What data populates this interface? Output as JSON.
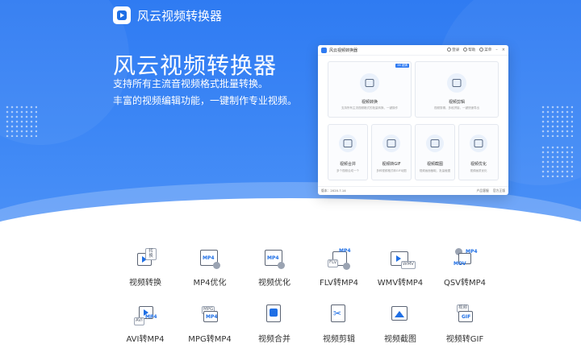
{
  "brand": {
    "name": "风云视频转换器"
  },
  "hero": {
    "title": "风云视频转换器",
    "line1": "支持所有主流音视频格式批量转换。",
    "line2": "丰富的视频编辑功能，一键制作专业视频。"
  },
  "app_window": {
    "title": "风云视频转换器",
    "controls": {
      "login": "登录",
      "menu": "帮助",
      "feedback": "菜单"
    },
    "cards": [
      {
        "label": "视频转换",
        "desc": "支持所有主流视频格式的批量转换，一键操作",
        "badge": "4K 超清"
      },
      {
        "label": "视频剪辑",
        "desc": "视频剪辑，多段拼接，一键快速导出"
      },
      {
        "label": "视频合并",
        "desc": "多个视频合成一个"
      },
      {
        "label": "视频转GIF",
        "desc": "多种视频格式转GIF动图"
      },
      {
        "label": "视频截图",
        "desc": "视频画面截取，批量截图"
      },
      {
        "label": "视频优化",
        "desc": "视频画质优化"
      }
    ],
    "status": {
      "version": "版本：2020.7.14",
      "client": "产品客服",
      "official": "官方正版"
    }
  },
  "tools": [
    {
      "label": "视频转换",
      "icon": "convert-icon"
    },
    {
      "label": "MP4优化",
      "icon": "mp4-optimize-icon"
    },
    {
      "label": "视频优化",
      "icon": "video-optimize-icon"
    },
    {
      "label": "FLV转MP4",
      "icon": "flv-mp4-icon"
    },
    {
      "label": "WMV转MP4",
      "icon": "wmv-mp4-icon"
    },
    {
      "label": "QSV转MP4",
      "icon": "qsv-mp4-icon"
    },
    {
      "label": "AVI转MP4",
      "icon": "avi-mp4-icon"
    },
    {
      "label": "MPG转MP4",
      "icon": "mpg-mp4-icon"
    },
    {
      "label": "视频合并",
      "icon": "merge-icon"
    },
    {
      "label": "视频剪辑",
      "icon": "cut-icon"
    },
    {
      "label": "视频截图",
      "icon": "screenshot-icon"
    },
    {
      "label": "视频转GIF",
      "icon": "gif-icon"
    }
  ],
  "icon_tags": {
    "convert": "转换",
    "mp4": "MP4",
    "flv": "FLV",
    "wmv": "WMV",
    "mov": "MOV",
    "avi": "AVI",
    "mpg": "MPG",
    "gif": "GIF",
    "video": "视频"
  },
  "colors": {
    "brand_blue": "#2f7bf2",
    "accent_blue": "#1f6fe5",
    "icon_gray": "#5b6474"
  }
}
